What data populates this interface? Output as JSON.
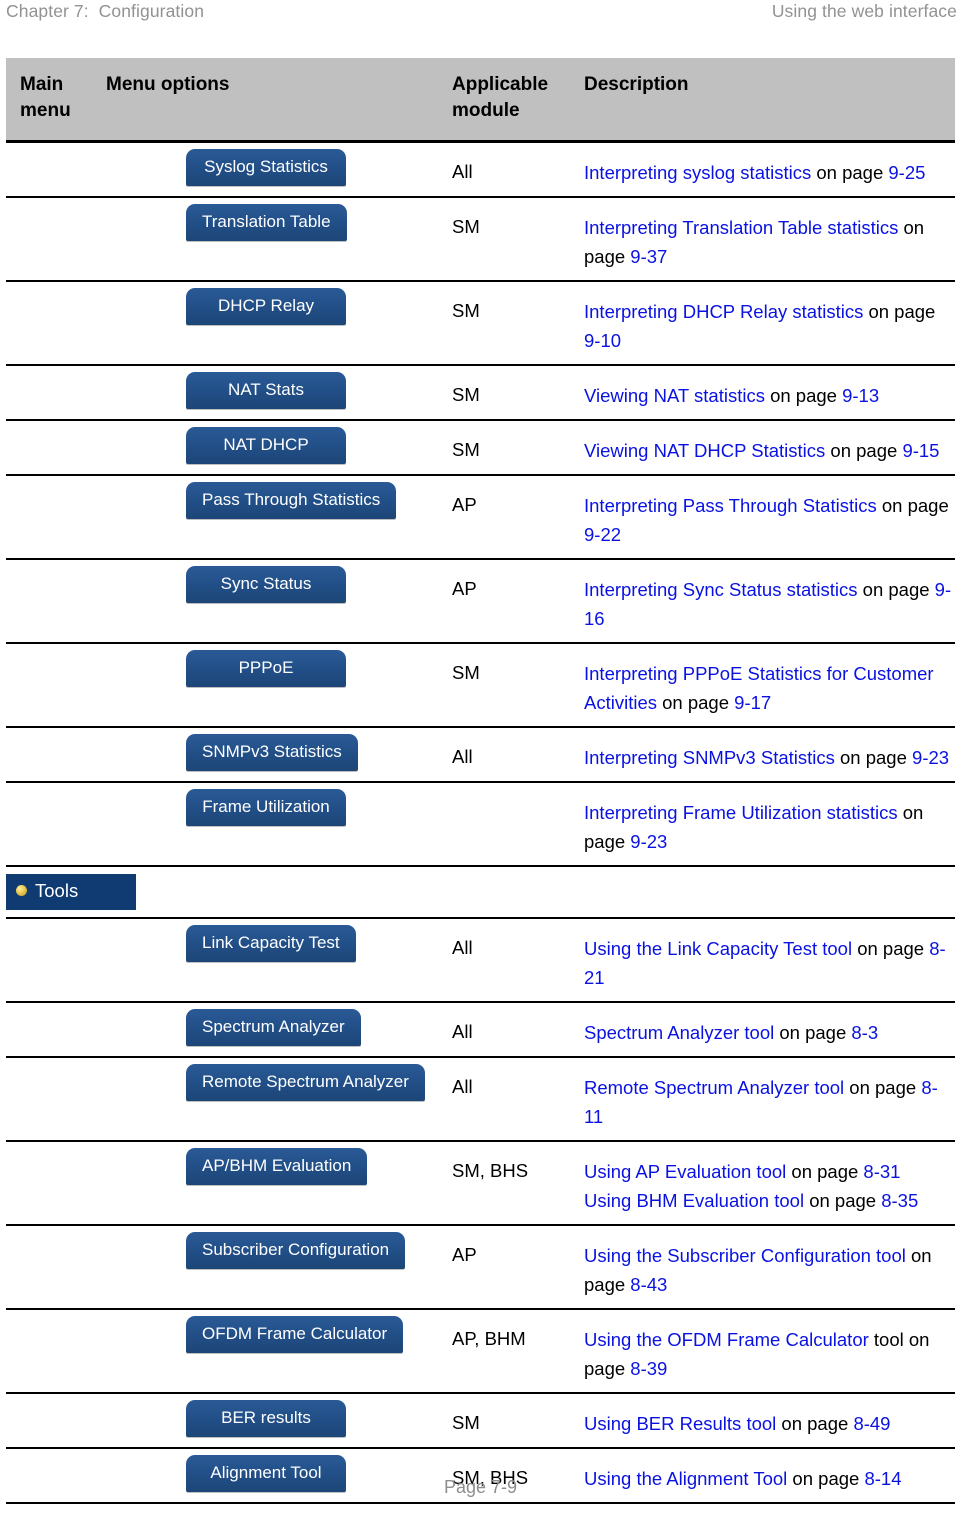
{
  "running_header": {
    "left": "Chapter 7:  Configuration",
    "right": "Using the web interface"
  },
  "table": {
    "headers": {
      "main_menu": "Main menu",
      "menu_options": "Menu options",
      "applicable_module": "Applicable module",
      "description": "Description"
    },
    "rows": [
      {
        "button": "Syslog Statistics",
        "module": "All",
        "desc_parts": [
          {
            "text": "Interpreting syslog statistics",
            "link": true
          },
          {
            "text": " on page ",
            "link": false
          },
          {
            "text": "9-25",
            "link": true
          }
        ]
      },
      {
        "button": "Translation Table",
        "module": "SM",
        "desc_parts": [
          {
            "text": "Interpreting Translation Table statistics",
            "link": true
          },
          {
            "text": " on page ",
            "link": false
          },
          {
            "text": "9-37",
            "link": true
          }
        ]
      },
      {
        "button": "DHCP Relay",
        "module": "SM",
        "desc_parts": [
          {
            "text": "Interpreting DHCP Relay statistics",
            "link": true
          },
          {
            "text": " on page ",
            "link": false
          },
          {
            "text": "9-10",
            "link": true
          }
        ]
      },
      {
        "button": "NAT Stats",
        "module": "SM",
        "desc_parts": [
          {
            "text": "Viewing NAT statistics",
            "link": true
          },
          {
            "text": " on page ",
            "link": false
          },
          {
            "text": "9-13",
            "link": true
          }
        ]
      },
      {
        "button": "NAT DHCP",
        "module": "SM",
        "desc_parts": [
          {
            "text": "Viewing NAT DHCP Statistics",
            "link": true
          },
          {
            "text": " on page ",
            "link": false
          },
          {
            "text": "9-15",
            "link": true
          }
        ]
      },
      {
        "button": "Pass Through Statistics",
        "module": "AP",
        "desc_parts": [
          {
            "text": "Interpreting Pass Through Statistics",
            "link": true
          },
          {
            "text": " on page ",
            "link": false
          },
          {
            "text": "9-22",
            "link": true
          }
        ]
      },
      {
        "button": "Sync Status",
        "module": "AP",
        "desc_parts": [
          {
            "text": "Interpreting Sync Status statistics",
            "link": true
          },
          {
            "text": " on page ",
            "link": false
          },
          {
            "text": "9-16",
            "link": true
          }
        ]
      },
      {
        "button": "PPPoE",
        "module": "SM",
        "desc_parts": [
          {
            "text": "Interpreting PPPoE Statistics for Customer Activities",
            "link": true
          },
          {
            "text": " on page ",
            "link": false
          },
          {
            "text": "9-17",
            "link": true
          }
        ]
      },
      {
        "button": "SNMPv3 Statistics",
        "module": "All",
        "desc_parts": [
          {
            "text": "Interpreting SNMPv3 Statistics",
            "link": true
          },
          {
            "text": " on page ",
            "link": false
          },
          {
            "text": "9-23",
            "link": true
          }
        ]
      },
      {
        "button": "Frame Utilization",
        "module": "",
        "desc_parts": [
          {
            "text": "Interpreting Frame Utilization statistics",
            "link": true
          },
          {
            "text": " on page ",
            "link": false
          },
          {
            "text": "9-23",
            "link": true
          }
        ]
      }
    ],
    "section": {
      "label": "Tools",
      "bullet_icon": "gold-sphere-bullet-icon"
    },
    "tools_rows": [
      {
        "button": "Link Capacity Test",
        "module": "All",
        "desc_parts": [
          {
            "text": "Using the Link Capacity Test tool",
            "link": true
          },
          {
            "text": " on page ",
            "link": false
          },
          {
            "text": "8-21",
            "link": true
          }
        ]
      },
      {
        "button": "Spectrum Analyzer",
        "module": "All",
        "desc_parts": [
          {
            "text": "Spectrum Analyzer tool",
            "link": true
          },
          {
            "text": " on page ",
            "link": false
          },
          {
            "text": "8-3",
            "link": true
          }
        ]
      },
      {
        "button": "Remote Spectrum Analyzer",
        "module": "All",
        "desc_parts": [
          {
            "text": "Remote Spectrum Analyzer tool",
            "link": true
          },
          {
            "text": " on page ",
            "link": false
          },
          {
            "text": "8-11",
            "link": true
          }
        ]
      },
      {
        "button": "AP/BHM Evaluation",
        "module": "SM, BHS",
        "desc_parts": [
          {
            "text": "Using AP Evaluation tool",
            "link": true
          },
          {
            "text": " on page ",
            "link": false
          },
          {
            "text": "8-31",
            "link": true
          },
          {
            "text": "\n",
            "link": false
          },
          {
            "text": "Using BHM Evaluation tool",
            "link": true
          },
          {
            "text": " on page ",
            "link": false
          },
          {
            "text": "8-35",
            "link": true
          }
        ]
      },
      {
        "button": "Subscriber Configuration",
        "module": "AP",
        "desc_parts": [
          {
            "text": "Using the Subscriber Configuration tool",
            "link": true
          },
          {
            "text": " on page ",
            "link": false
          },
          {
            "text": "8-43",
            "link": true
          }
        ]
      },
      {
        "button": "OFDM Frame Calculator",
        "module": "AP, BHM",
        "desc_parts": [
          {
            "text": "Using the OFDM Frame Calculator",
            "link": true
          },
          {
            "text": " tool on page ",
            "link": false
          },
          {
            "text": "8-39",
            "link": true
          }
        ]
      },
      {
        "button": "BER results",
        "module": "SM",
        "desc_parts": [
          {
            "text": "Using BER Results tool",
            "link": true
          },
          {
            "text": " on page ",
            "link": false
          },
          {
            "text": "8-49",
            "link": true
          }
        ]
      },
      {
        "button": "Alignment Tool",
        "module": "SM, BHS",
        "desc_parts": [
          {
            "text": "Using the Alignment Tool",
            "link": true
          },
          {
            "text": " on page ",
            "link": false
          },
          {
            "text": "8-14",
            "link": true
          }
        ]
      }
    ]
  },
  "footer": {
    "page_label": "Page 7-9"
  },
  "colors": {
    "nav_button": "#24528c",
    "section_banner": "#103a72",
    "header_row": "#c0c0c0",
    "link": "#0a12e2",
    "running_header_text": "#929292",
    "footer_text": "#8d8d8d",
    "bullet_gold": "#e9c84e"
  }
}
